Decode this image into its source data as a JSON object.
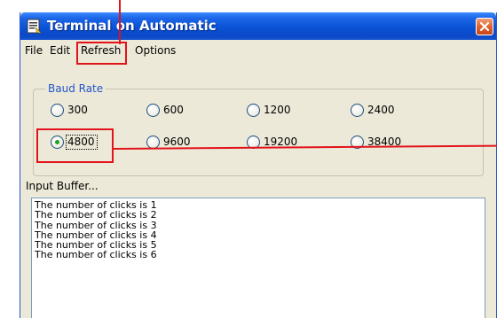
{
  "window": {
    "title": "Terminal on Automatic"
  },
  "menu": {
    "items": [
      "File",
      "Edit",
      "Refresh",
      "Options"
    ]
  },
  "baud_rate": {
    "legend": "Baud Rate",
    "options": [
      "300",
      "600",
      "1200",
      "2400",
      "4800",
      "9600",
      "19200",
      "38400"
    ],
    "selected": "4800"
  },
  "input_buffer": {
    "label": "Input Buffer...",
    "lines": [
      "The number of clicks is 1",
      "The number of clicks is 2",
      "The number of clicks is 3",
      "The number of clicks is 4",
      "The number of clicks is 5",
      "The number of clicks is 6"
    ]
  },
  "colors": {
    "titlebar": "#0a52d6",
    "annotation": "#e2131b",
    "legend_text": "#2354c8",
    "window_bg": "#ece9d8"
  },
  "icons": {
    "title_icon": "terminal-window-icon",
    "close_icon": "close-x-icon"
  }
}
